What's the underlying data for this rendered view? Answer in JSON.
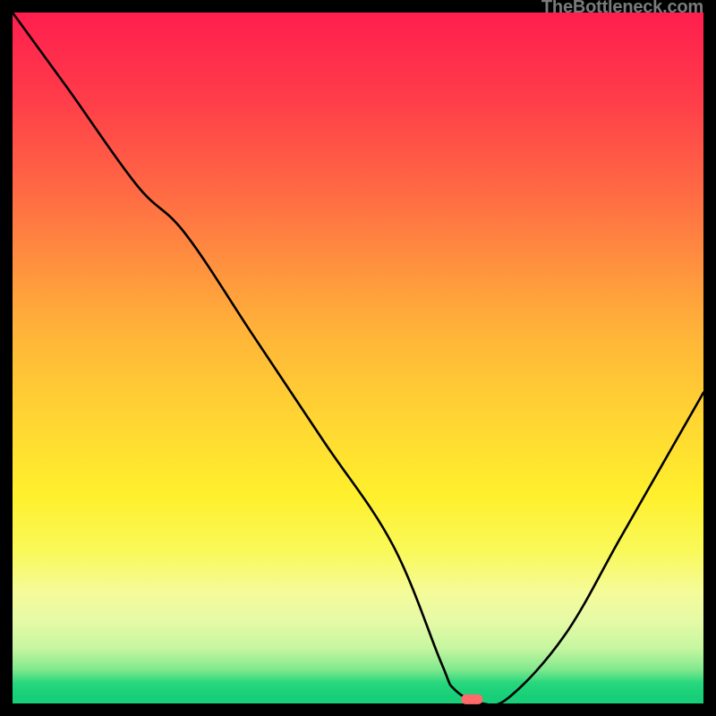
{
  "watermark_text": "TheBottleneck.com",
  "chart_data": {
    "type": "line",
    "title": "",
    "xlabel": "",
    "ylabel": "",
    "xlim": [
      0,
      100
    ],
    "ylim": [
      0,
      100
    ],
    "series": [
      {
        "name": "bottleneck-curve",
        "x": [
          0,
          8,
          18,
          25,
          35,
          45,
          55,
          62,
          64,
          68,
          72,
          80,
          88,
          96,
          100
        ],
        "y": [
          100,
          89,
          75,
          68,
          53,
          38,
          23,
          6,
          2,
          0,
          1,
          10,
          24,
          38,
          45
        ]
      }
    ],
    "marker": {
      "x": 66.5,
      "y": 0.6,
      "color": "#ff6b6b"
    },
    "stroke_color": "#000000",
    "stroke_width": 2.6
  }
}
